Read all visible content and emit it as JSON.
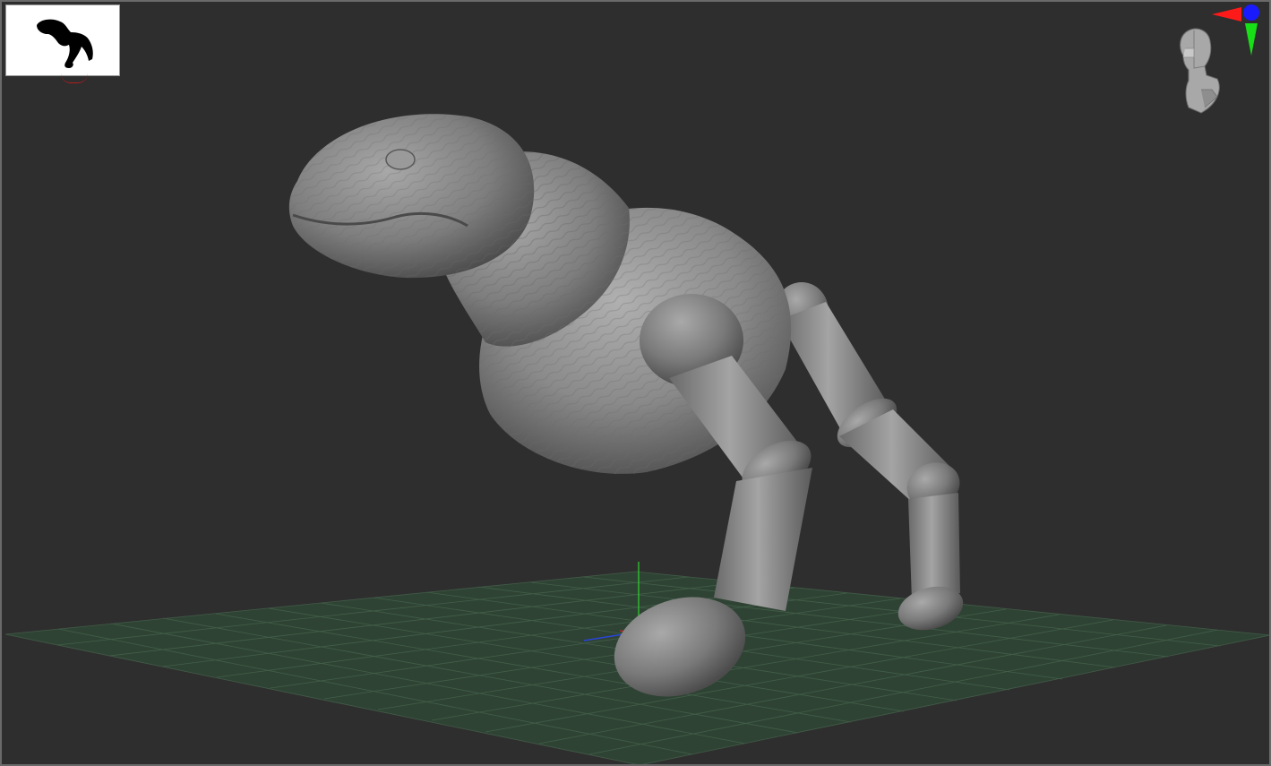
{
  "viewport": {
    "background": "#2e2e2e",
    "border_color": "#6a6a6a"
  },
  "floor_grid": {
    "color": "#2f4a34",
    "line_color": "#4a6a52",
    "visible": true
  },
  "model": {
    "material_color": "#8a8a8a"
  },
  "navigator": {
    "icon": "creature-silhouette-icon",
    "background": "#ffffff"
  },
  "orientation_gizmo": {
    "icon": "head-orientation-icon",
    "axis_x_color": "#ff1a1a",
    "axis_y_color": "#17e017",
    "axis_z_color": "#1a1aff"
  }
}
